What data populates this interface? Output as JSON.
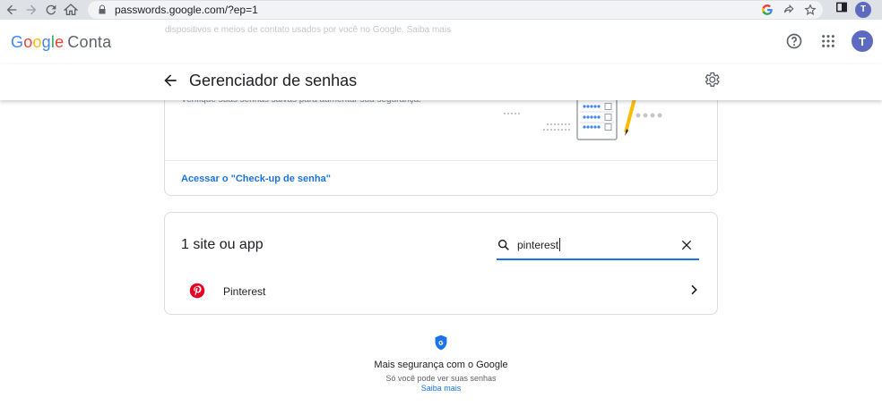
{
  "browser": {
    "url": "passwords.google.com/?ep=1",
    "profile_initial": "T"
  },
  "header": {
    "logo_parts": [
      "G",
      "o",
      "o",
      "g",
      "l",
      "e"
    ],
    "product_name": "Conta",
    "faded_text": "dispositivos e meios de contato usados por você no Google. Saiba mais",
    "profile_initial": "T"
  },
  "pagebar": {
    "title": "Gerenciador de senhas"
  },
  "checkup_card": {
    "description": "Verifique suas senhas salvas para aumentar sua segurança.",
    "link_label": "Acessar o \"Check-up de senha\""
  },
  "results_card": {
    "count_label": "1 site ou app",
    "search_value": "pinterest",
    "rows": [
      {
        "name": "Pinterest",
        "icon": "pinterest-icon"
      }
    ]
  },
  "footer": {
    "title": "Mais segurança com o Google",
    "subtitle": "Só você pode ver suas senhas",
    "link": "Saiba mais"
  },
  "colors": {
    "accent": "#1a73e8",
    "pinterest": "#e60023",
    "avatar": "#5c6bc0"
  }
}
